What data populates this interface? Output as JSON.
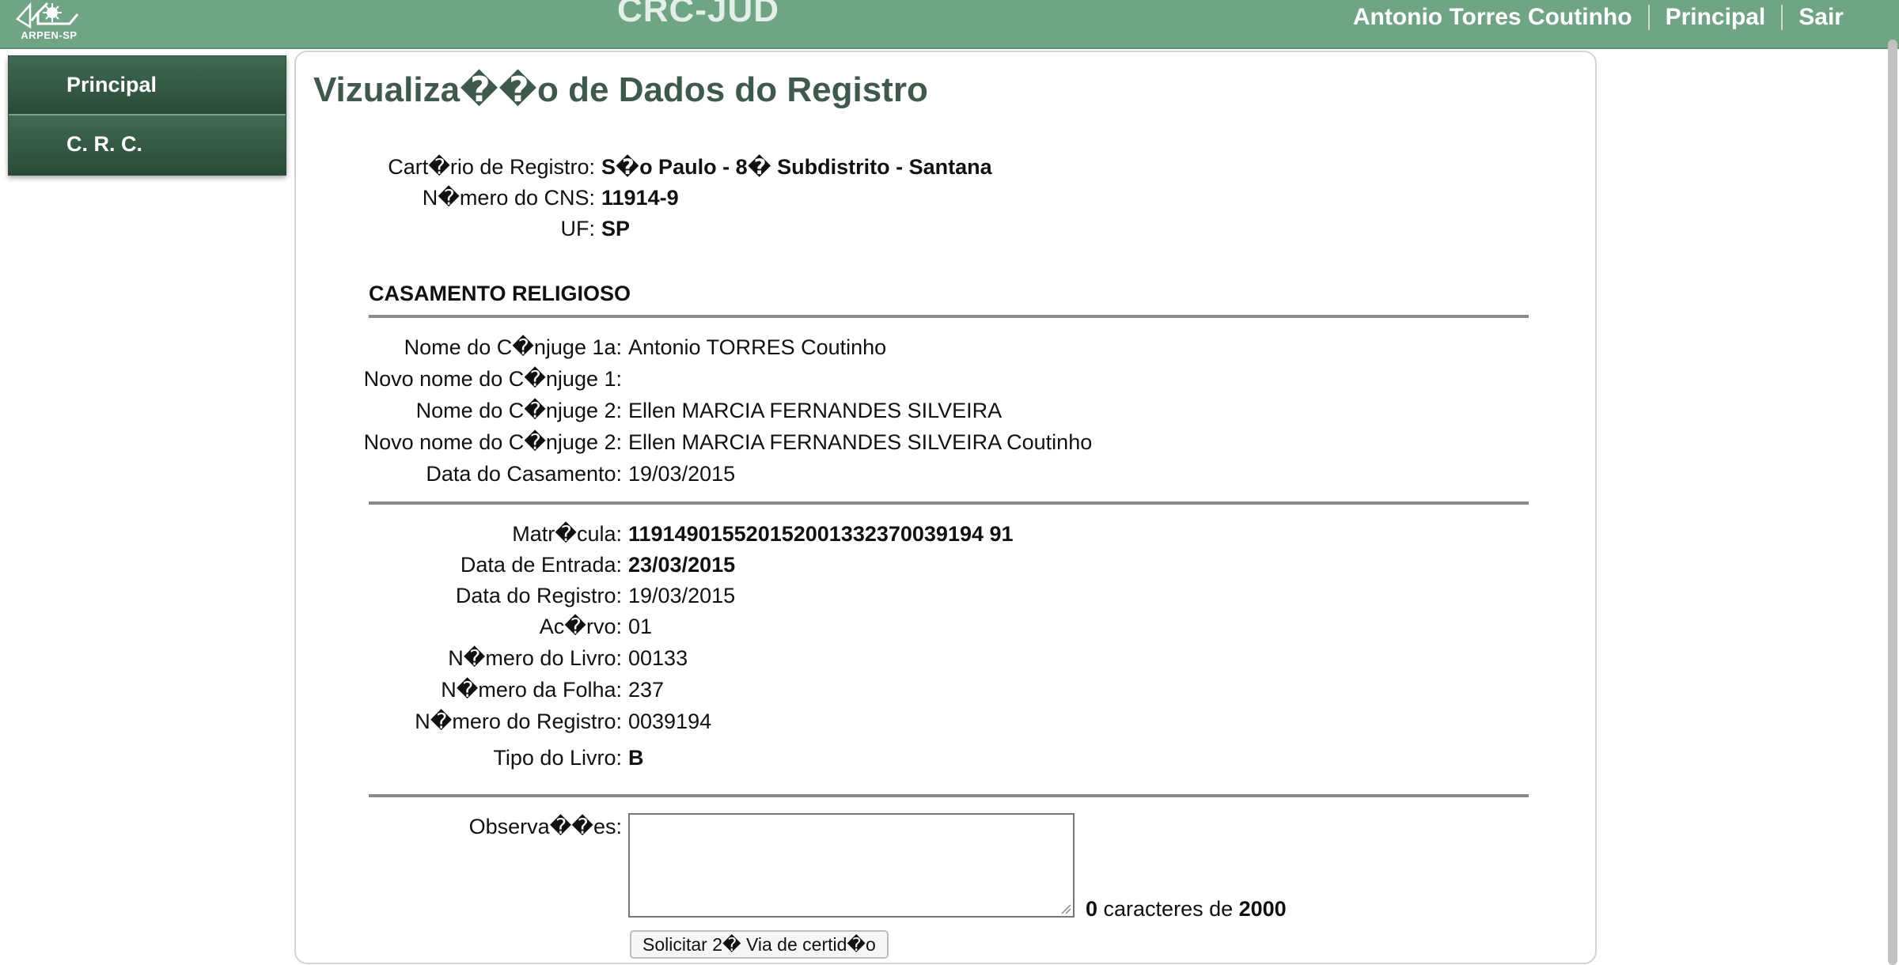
{
  "header": {
    "logo_text": "ARPEN-SP",
    "app_title": "CRC-JUD",
    "user_name": "Antonio Torres Coutinho",
    "nav_principal": "Principal",
    "nav_sair": "Sair"
  },
  "sidebar": {
    "items": [
      {
        "label": "Principal"
      },
      {
        "label": "C. R. C."
      }
    ]
  },
  "main": {
    "page_title": "Vizualiza��o de Dados do Registro",
    "cartorio": {
      "label": "Cart�rio de Registro:",
      "value": "S�o Paulo - 8� Subdistrito - Santana"
    },
    "cns": {
      "label": "N�mero do CNS:",
      "value": "11914-9"
    },
    "uf": {
      "label": "UF:",
      "value": "SP"
    },
    "section_title": "CASAMENTO RELIGIOSO",
    "spouses": [
      {
        "label": "Nome do C�njuge 1a:",
        "value": "Antonio TORRES Coutinho"
      },
      {
        "label": "Novo nome do C�njuge 1:",
        "value": ""
      },
      {
        "label": "Nome do C�njuge 2:",
        "value": "Ellen MARCIA FERNANDES SILVEIRA"
      },
      {
        "label": "Novo nome do C�njuge 2:",
        "value": "Ellen MARCIA FERNANDES SILVEIRA Coutinho"
      },
      {
        "label": "Data do Casamento:",
        "value": "19/03/2015"
      }
    ],
    "registry": [
      {
        "label": "Matr�cula:",
        "value": "119149015520152001332370039194 91"
      },
      {
        "label": "Data de Entrada:",
        "value": "23/03/2015"
      },
      {
        "label": "Data do Registro:",
        "value": "19/03/2015"
      },
      {
        "label": "Ac�rvo:",
        "value": "01"
      },
      {
        "label": "N�mero do Livro:",
        "value": "00133"
      },
      {
        "label": "N�mero da Folha:",
        "value": "237"
      },
      {
        "label": "N�mero do Registro:",
        "value": "0039194"
      },
      {
        "label": "Tipo do Livro:",
        "value": "B"
      }
    ],
    "observacoes": {
      "label": "Observa��es:",
      "value": "",
      "count": "0",
      "counter_mid": " caracteres de ",
      "max": "2000"
    },
    "submit_label": "Solicitar 2� Via de certid�o"
  }
}
